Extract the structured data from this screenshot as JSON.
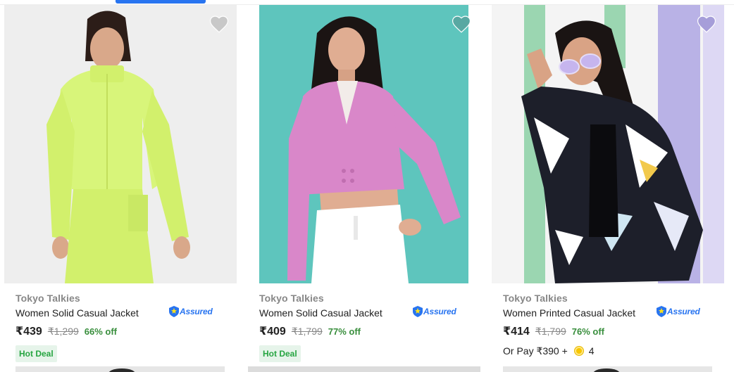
{
  "colors": {
    "accent": "#2874f0",
    "discount": "#388e3c",
    "hot_deal_bg": "#e6f4ea",
    "hot_deal_text": "#26a541",
    "muted": "#878787"
  },
  "products": [
    {
      "brand": "Tokyo Talkies",
      "title": "Women Solid Casual Jacket",
      "assured_label": "Assured",
      "price": "₹439",
      "mrp": "₹1,299",
      "discount": "66% off",
      "badge": "Hot Deal",
      "wishlist_icon": "heart-icon",
      "image_colors": {
        "bg": "#eeeeee",
        "garment": "#d8f57a"
      }
    },
    {
      "brand": "Tokyo Talkies",
      "title": "Women Solid Casual Jacket",
      "assured_label": "Assured",
      "price": "₹409",
      "mrp": "₹1,799",
      "discount": "77% off",
      "badge": "Hot Deal",
      "wishlist_icon": "heart-icon",
      "image_colors": {
        "bg": "#5ec5bd",
        "garment": "#d987c9"
      }
    },
    {
      "brand": "Tokyo Talkies",
      "title": "Women Printed Casual Jacket",
      "assured_label": "Assured",
      "price": "₹414",
      "mrp": "₹1,799",
      "discount": "76% off",
      "or_pay_text": "Or Pay ₹390 +",
      "coins": "4",
      "wishlist_icon": "heart-icon",
      "image_colors": {
        "bg": "#f4f4f4",
        "garment": "#1d1f2a"
      }
    }
  ]
}
